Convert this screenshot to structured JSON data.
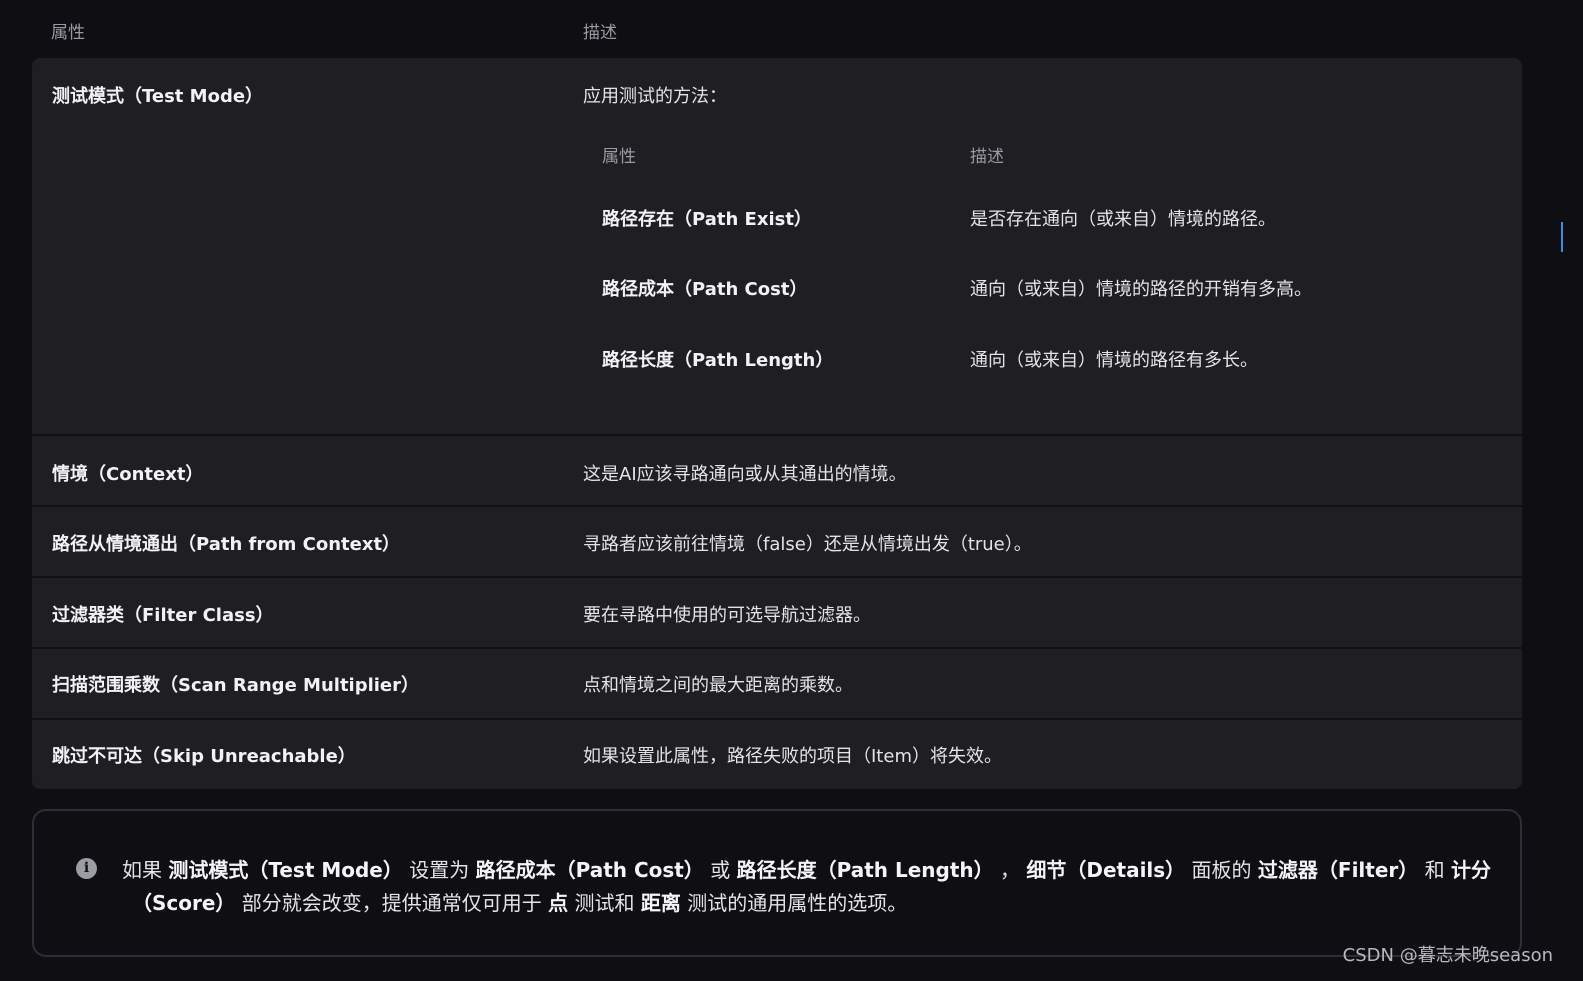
{
  "header": {
    "col_property": "属性",
    "col_description": "描述"
  },
  "rows": [
    {
      "name": "测试模式（Test Mode）",
      "desc": "应用测试的方法："
    },
    {
      "name": "情境（Context）",
      "desc": "这是AI应该寻路通向或从其通出的情境。"
    },
    {
      "name": "路径从情境通出（Path from Context）",
      "desc": "寻路者应该前往情境（false）还是从情境出发（true）。"
    },
    {
      "name": "过滤器类（Filter Class）",
      "desc": "要在寻路中使用的可选导航过滤器。"
    },
    {
      "name": "扫描范围乘数（Scan Range Multiplier）",
      "desc": "点和情境之间的最大距离的乘数。"
    },
    {
      "name": "跳过不可达（Skip Unreachable）",
      "desc": "如果设置此属性，路径失败的项目（Item）将失效。"
    }
  ],
  "inner": {
    "col_property": "属性",
    "col_description": "描述",
    "rows": [
      {
        "name": "路径存在（Path Exist）",
        "desc": "是否存在通向（或来自）情境的路径。"
      },
      {
        "name": "路径成本（Path Cost）",
        "desc": "通向（或来自）情境的路径的开销有多高。"
      },
      {
        "name": "路径长度（Path Length）",
        "desc": "通向（或来自）情境的路径有多长。"
      }
    ]
  },
  "note": {
    "icon": "info-icon",
    "l1_a": "如果 ",
    "l1_b": "测试模式（Test Mode）",
    "l1_c": " 设置为 ",
    "l1_d": "路径成本（Path Cost）",
    "l1_e": " 或 ",
    "l1_f": "路径长度（Path Length）",
    "l1_g": " ， ",
    "l1_h": "细节（Details）",
    "l1_i": " 面板的 ",
    "l1_j": "过滤器（Filter）",
    "l1_k": " 和 ",
    "l1_l": "计分",
    "l2_a": "（Score）",
    "l2_b": " 部分就会改变，提供通常仅可用于 ",
    "l2_c": "点",
    "l2_d": " 测试和 ",
    "l2_e": "距离",
    "l2_f": " 测试的通用属性的选项。"
  },
  "watermark": "CSDN @暮志未晚season"
}
